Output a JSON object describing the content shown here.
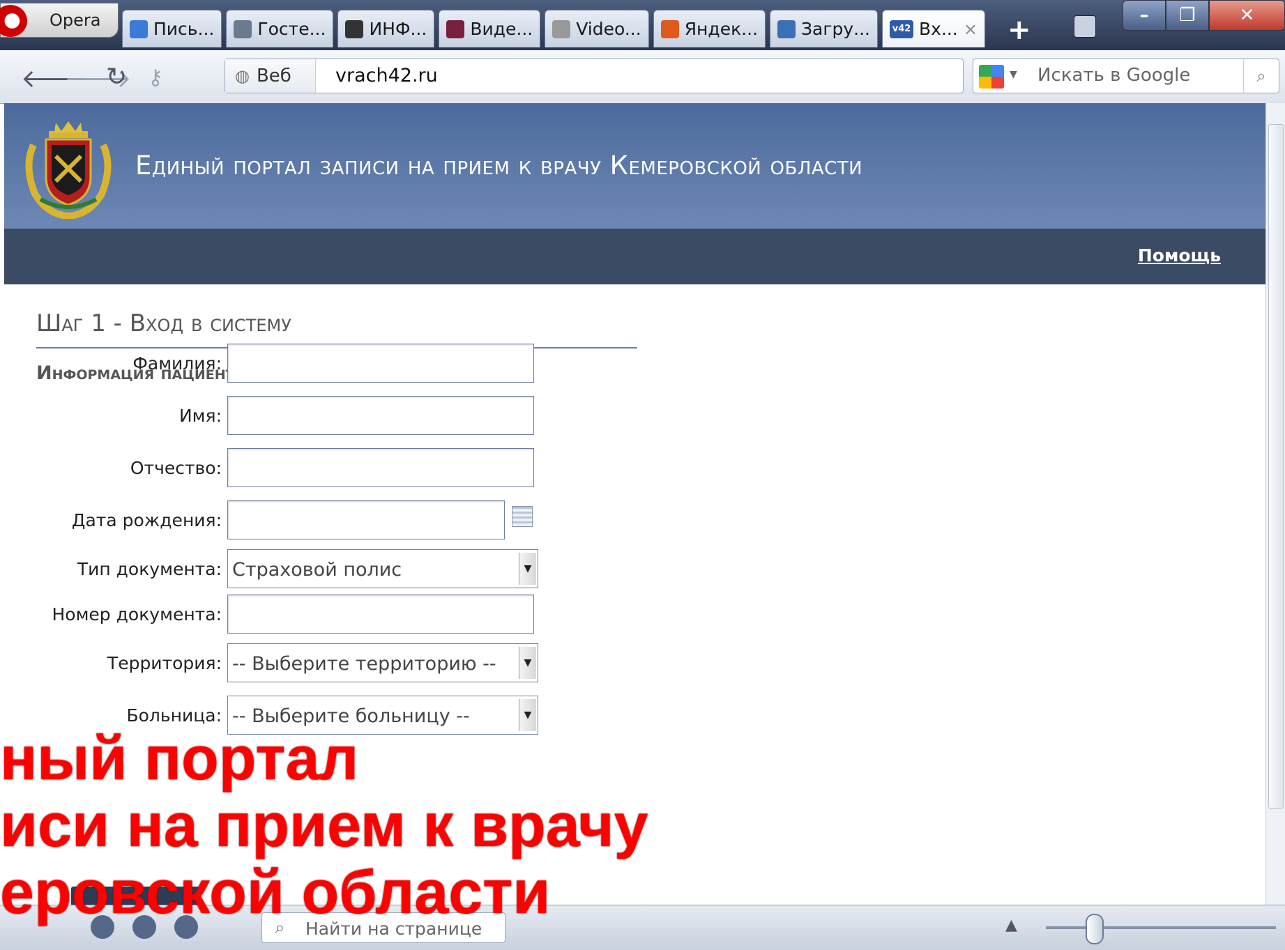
{
  "browser": {
    "opera_label": "Opera",
    "tabs": [
      {
        "label": "Пись...",
        "icon": "mail-icon",
        "color": "#3a7bd5"
      },
      {
        "label": "Госте...",
        "icon": "page-icon",
        "color": "#6b7a8f"
      },
      {
        "label": "ИНФ...",
        "icon": "link-icon",
        "color": "#333333"
      },
      {
        "label": "Виде...",
        "icon": "diamond-icon",
        "color": "#7a1f3d"
      },
      {
        "label": "Video...",
        "icon": "loading-icon",
        "color": "#999999"
      },
      {
        "label": "Яндек...",
        "icon": "people-icon",
        "color": "#e05a1c"
      },
      {
        "label": "Загру...",
        "icon": "download-icon",
        "color": "#3b6fb6"
      },
      {
        "label": "Вх...",
        "icon": "v42-icon",
        "color": "#2f5aa8",
        "badge": "v42"
      }
    ],
    "address": {
      "mode": "Веб",
      "url": "vrach42.ru"
    },
    "search": {
      "placeholder": "Искать в Google"
    },
    "find": {
      "placeholder": "Найти на странице"
    }
  },
  "site": {
    "title": "Единый портал записи на прием к врачу Кемеровской области",
    "help_link": "Помощь",
    "step_title": "Шаг 1 - Вход в систему",
    "section_title": "Информация пациента",
    "fields": [
      {
        "label": "Фамилия:",
        "type": "text",
        "value": ""
      },
      {
        "label": "Имя:",
        "type": "text",
        "value": ""
      },
      {
        "label": "Отчество:",
        "type": "text",
        "value": ""
      },
      {
        "label": "Дата рождения:",
        "type": "date",
        "value": ""
      },
      {
        "label": "Тип документа:",
        "type": "select",
        "value": "Страховой полис"
      },
      {
        "label": "Номер документа:",
        "type": "text",
        "value": ""
      },
      {
        "label": "Территория:",
        "type": "select",
        "value": "-- Выберите территорию --"
      },
      {
        "label": "Больница:",
        "type": "select",
        "value": "-- Выберите больницу --"
      }
    ]
  },
  "overlay": {
    "lines": [
      "ный портал",
      "иси на прием к врачу",
      "еровской области"
    ],
    "color": "#ff0000"
  }
}
